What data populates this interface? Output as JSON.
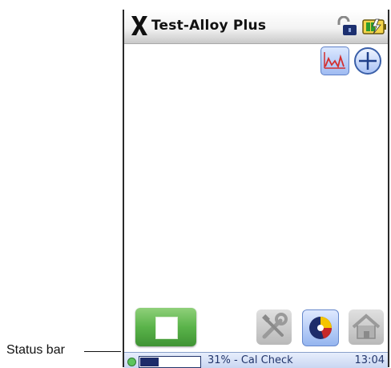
{
  "app": {
    "title": "Test-Alloy Plus"
  },
  "icons": {
    "close": "close-x-icon",
    "lock": "padlock-open-icon",
    "battery": "battery-icon",
    "graph": "spectrum-graph-icon",
    "add": "plus-circle-icon",
    "start": "stop-square-icon",
    "tools": "tools-icon",
    "results": "pie-chart-icon",
    "home": "home-icon"
  },
  "status": {
    "progress_percent": 31,
    "text": "31% - Cal Check",
    "time": "13:04"
  },
  "callout": {
    "label": "Status bar"
  },
  "colors": {
    "start_green": "#5ab34a",
    "status_bg": "#d7e1f7",
    "accent_blue": "#3a5fa8",
    "pie_red": "#c62828",
    "pie_yellow": "#f5c400",
    "pie_navy": "#1d2c6a"
  }
}
